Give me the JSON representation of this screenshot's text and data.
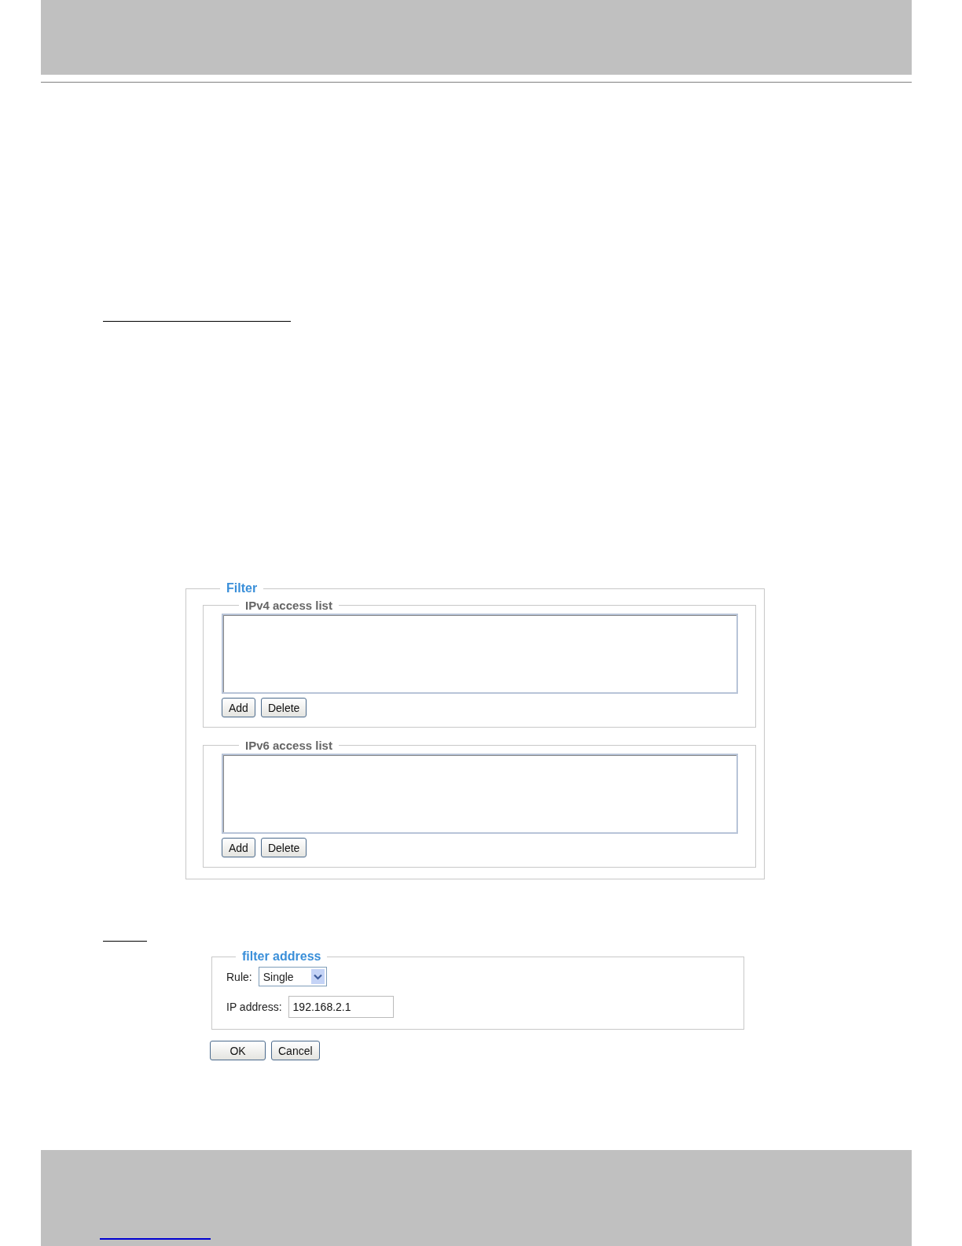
{
  "filter_panel": {
    "legend": "Filter",
    "lists": [
      {
        "legend": "IPv4 access list",
        "buttons": [
          "Add",
          "Delete"
        ]
      },
      {
        "legend": "IPv6 access list",
        "buttons": [
          "Add",
          "Delete"
        ]
      }
    ]
  },
  "filter_address_dialog": {
    "legend": "filter address",
    "rule": {
      "label": "Rule:",
      "value": "Single"
    },
    "ip_address": {
      "label": "IP address:",
      "value": "192.168.2.1"
    },
    "buttons": [
      "OK",
      "Cancel"
    ]
  }
}
